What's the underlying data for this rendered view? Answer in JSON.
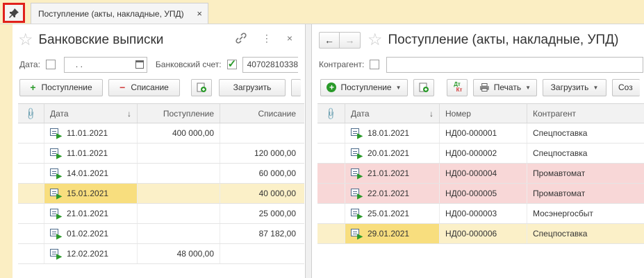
{
  "tabs": {
    "active_title": "Поступление (акты, накладные, УПД)",
    "close_glyph": "×"
  },
  "left": {
    "title": "Банковские выписки",
    "filter": {
      "date_label": "Дата:",
      "date_value": ". .",
      "account_label": "Банковский счет:",
      "account_value": "40702810338"
    },
    "toolbar": {
      "income": "Поступление",
      "expense": "Списание",
      "load": "Загрузить"
    },
    "columns": {
      "date": "Дата",
      "income": "Поступление",
      "expense": "Списание"
    },
    "rows": [
      {
        "date": "11.01.2021",
        "income": "400 000,00",
        "expense": ""
      },
      {
        "date": "11.01.2021",
        "income": "",
        "expense": "120 000,00"
      },
      {
        "date": "14.01.2021",
        "income": "",
        "expense": "60 000,00"
      },
      {
        "date": "15.01.2021",
        "income": "",
        "expense": "40 000,00"
      },
      {
        "date": "21.01.2021",
        "income": "",
        "expense": "25 000,00"
      },
      {
        "date": "01.02.2021",
        "income": "",
        "expense": "87 182,00"
      },
      {
        "date": "12.02.2021",
        "income": "48 000,00",
        "expense": ""
      }
    ]
  },
  "right": {
    "title": "Поступление (акты, накладные, УПД)",
    "filter": {
      "contractor_label": "Контрагент:"
    },
    "toolbar": {
      "income": "Поступление",
      "dtkt_top": "Дт",
      "dtkt_bottom": "Кт",
      "print": "Печать",
      "load": "Загрузить",
      "create": "Соз"
    },
    "columns": {
      "date": "Дата",
      "number": "Номер",
      "contractor": "Контрагент"
    },
    "rows": [
      {
        "date": "18.01.2021",
        "number": "НД00-000001",
        "contractor": "Спецпоставка"
      },
      {
        "date": "20.01.2021",
        "number": "НД00-000002",
        "contractor": "Спецпоставка"
      },
      {
        "date": "21.01.2021",
        "number": "НД00-000004",
        "contractor": "Промавтомат"
      },
      {
        "date": "22.01.2021",
        "number": "НД00-000005",
        "contractor": "Промавтомат"
      },
      {
        "date": "25.01.2021",
        "number": "НД00-000003",
        "contractor": "Мосэнергосбыт"
      },
      {
        "date": "29.01.2021",
        "number": "НД00-000006",
        "contractor": "Спецпоставка"
      }
    ]
  },
  "icons": {
    "pin": "pin-icon",
    "star": "star-icon",
    "link": "link-icon",
    "more": "more-icon",
    "close": "close-icon",
    "back": "back-arrow-icon",
    "forward": "forward-arrow-icon",
    "calendar": "calendar-icon",
    "paperclip": "paperclip-icon",
    "sort": "sort-down-icon",
    "document": "document-icon",
    "printer": "printer-icon"
  },
  "colors": {
    "accent_pink": "#f8d7d7",
    "selected_row": "#fbf0c8",
    "selected_cell": "#f8de7e",
    "highlight_border": "#e0201b"
  }
}
